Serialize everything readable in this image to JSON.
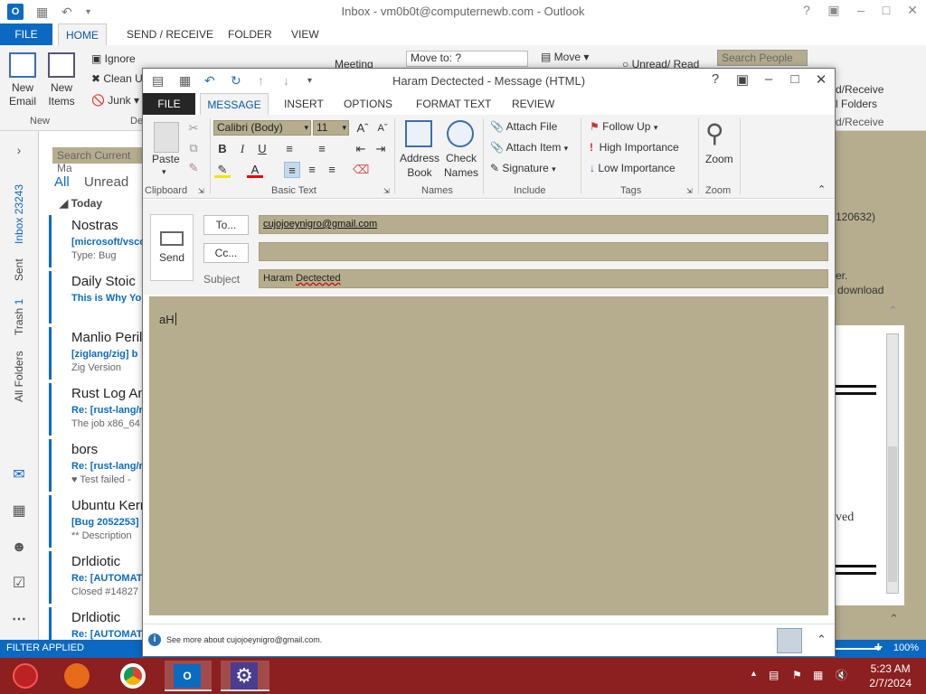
{
  "main": {
    "title": "Inbox - vm0b0t@computernewb.com - Outlook",
    "tabs": [
      "FILE",
      "HOME",
      "SEND / RECEIVE",
      "FOLDER",
      "VIEW"
    ],
    "ribbon": {
      "new_email": "New\nEmail",
      "new_items": "New\nItems",
      "group_new": "New",
      "ignore": "Ignore",
      "clean_up": "Clean U",
      "junk": "Junk",
      "group_delete": "De",
      "move_to": "Move to: ?",
      "move": "Move",
      "meeting": "Meeting",
      "unread_read": "Unread/ Read",
      "search_people": "Search People",
      "send_receive_all": "d/Receive",
      "all_folders": "l Folders",
      "group_send_receive": "d/Receive"
    },
    "nav": {
      "inbox_label": "Inbox",
      "inbox_count": "23243",
      "sent": "Sent",
      "trash_label": "Trash",
      "trash_count": "1",
      "all_folders": "All Folders"
    },
    "list": {
      "search_placeholder": "Search Current Ma",
      "filter_all": "All",
      "filter_unread": "Unread",
      "today": "Today",
      "items": [
        {
          "sender": "Nostras",
          "subject": "[microsoft/vsco",
          "preview": "Type: Bug"
        },
        {
          "sender": "Daily Stoic",
          "subject": "This is Why Yo",
          "preview": ""
        },
        {
          "sender": "Manlio Peril",
          "subject": "[ziglang/zig] b",
          "preview": "Zig Version"
        },
        {
          "sender": "Rust Log An",
          "subject": "Re: [rust-lang/r",
          "preview": "The job x86_64"
        },
        {
          "sender": "bors",
          "subject": "Re: [rust-lang/r",
          "preview": "♥ Test failed -"
        },
        {
          "sender": "Ubuntu Kern",
          "subject": "[Bug 2052253]",
          "preview": "** Description"
        },
        {
          "sender": "Drldiotic",
          "subject": "Re: [AUTOMAT",
          "preview": "Closed #14827"
        },
        {
          "sender": "Drldiotic",
          "subject": "Re: [AUTOMAT",
          "preview": ""
        }
      ]
    },
    "reading": {
      "snippet1": "120632)",
      "snippet2": "er.",
      "snippet3": "download",
      "snippet4": "ved"
    },
    "status": {
      "filter": "FILTER APPLIED",
      "zoom": "100%"
    }
  },
  "compose": {
    "title": "Haram Dectected - Message (HTML)",
    "tabs": [
      "FILE",
      "MESSAGE",
      "INSERT",
      "OPTIONS",
      "FORMAT TEXT",
      "REVIEW"
    ],
    "ribbon": {
      "paste": "Paste",
      "clipboard": "Clipboard",
      "font_name": "Calibri (Body)",
      "font_size": "11",
      "basic_text": "Basic Text",
      "address_book": "Address\nBook",
      "check_names": "Check\nNames",
      "names": "Names",
      "attach_file": "Attach File",
      "attach_item": "Attach Item",
      "signature": "Signature",
      "include": "Include",
      "follow_up": "Follow Up",
      "high_importance": "High Importance",
      "low_importance": "Low Importance",
      "tags": "Tags",
      "zoom": "Zoom",
      "zoom_group": "Zoom"
    },
    "send": "Send",
    "to_button": "To...",
    "cc_button": "Cc...",
    "subject_label": "Subject",
    "to_value": "cujojoeynigro@gmail.com",
    "cc_value": "",
    "subject_value_a": "Haram ",
    "subject_value_b": "Dectected",
    "body": "aH",
    "people_pane": "See more about cujojoeynigro@gmail.com."
  },
  "taskbar": {
    "time": "5:23 AM",
    "date": "2/7/2024"
  },
  "colors": {
    "accent": "#0b69c2",
    "field_bg": "#b5ad8e",
    "taskbar": "#8c1f1f"
  }
}
